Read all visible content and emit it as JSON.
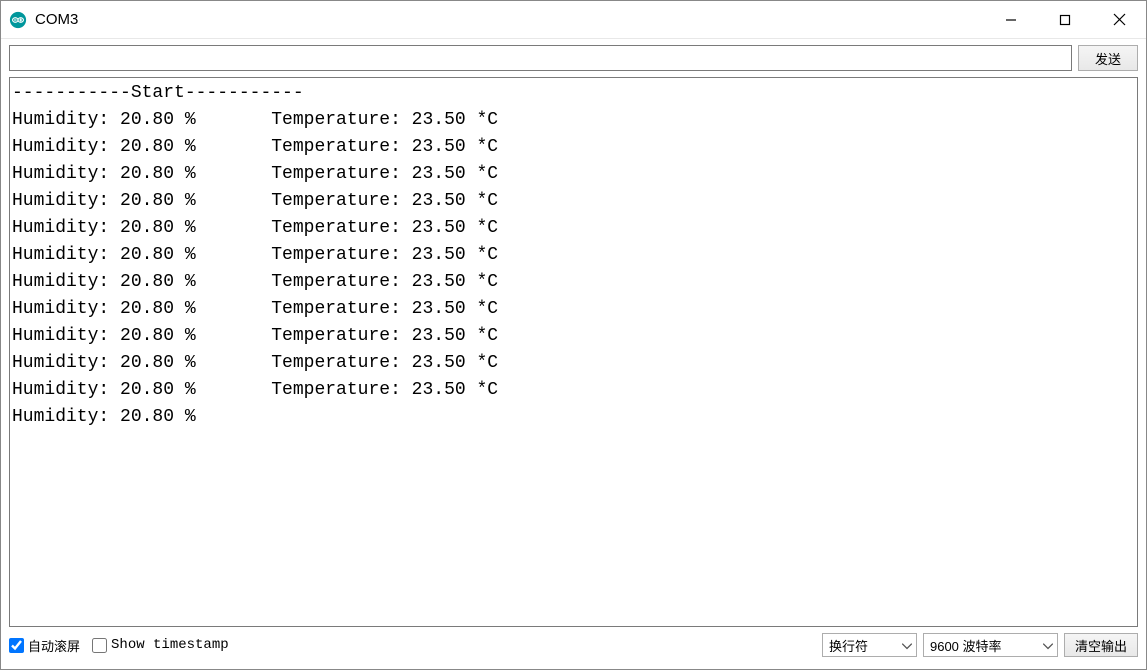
{
  "window": {
    "title": "COM3"
  },
  "toolbar": {
    "send_input_value": "",
    "send_button_label": "发送"
  },
  "output": {
    "lines": [
      "-----------Start-----------",
      "Humidity: 20.80 %\tTemperature: 23.50 *C",
      "Humidity: 20.80 %\tTemperature: 23.50 *C",
      "Humidity: 20.80 %\tTemperature: 23.50 *C",
      "Humidity: 20.80 %\tTemperature: 23.50 *C",
      "Humidity: 20.80 %\tTemperature: 23.50 *C",
      "Humidity: 20.80 %\tTemperature: 23.50 *C",
      "Humidity: 20.80 %\tTemperature: 23.50 *C",
      "Humidity: 20.80 %\tTemperature: 23.50 *C",
      "Humidity: 20.80 %\tTemperature: 23.50 *C",
      "Humidity: 20.80 %\tTemperature: 23.50 *C",
      "Humidity: 20.80 %\tTemperature: 23.50 *C",
      "Humidity: 20.80 %"
    ]
  },
  "bottombar": {
    "autoscroll_label": "自动滚屏",
    "autoscroll_checked": true,
    "timestamp_label": "Show timestamp",
    "timestamp_checked": false,
    "line_ending_selected": "换行符",
    "baud_selected": "9600 波特率",
    "clear_button_label": "清空输出"
  }
}
